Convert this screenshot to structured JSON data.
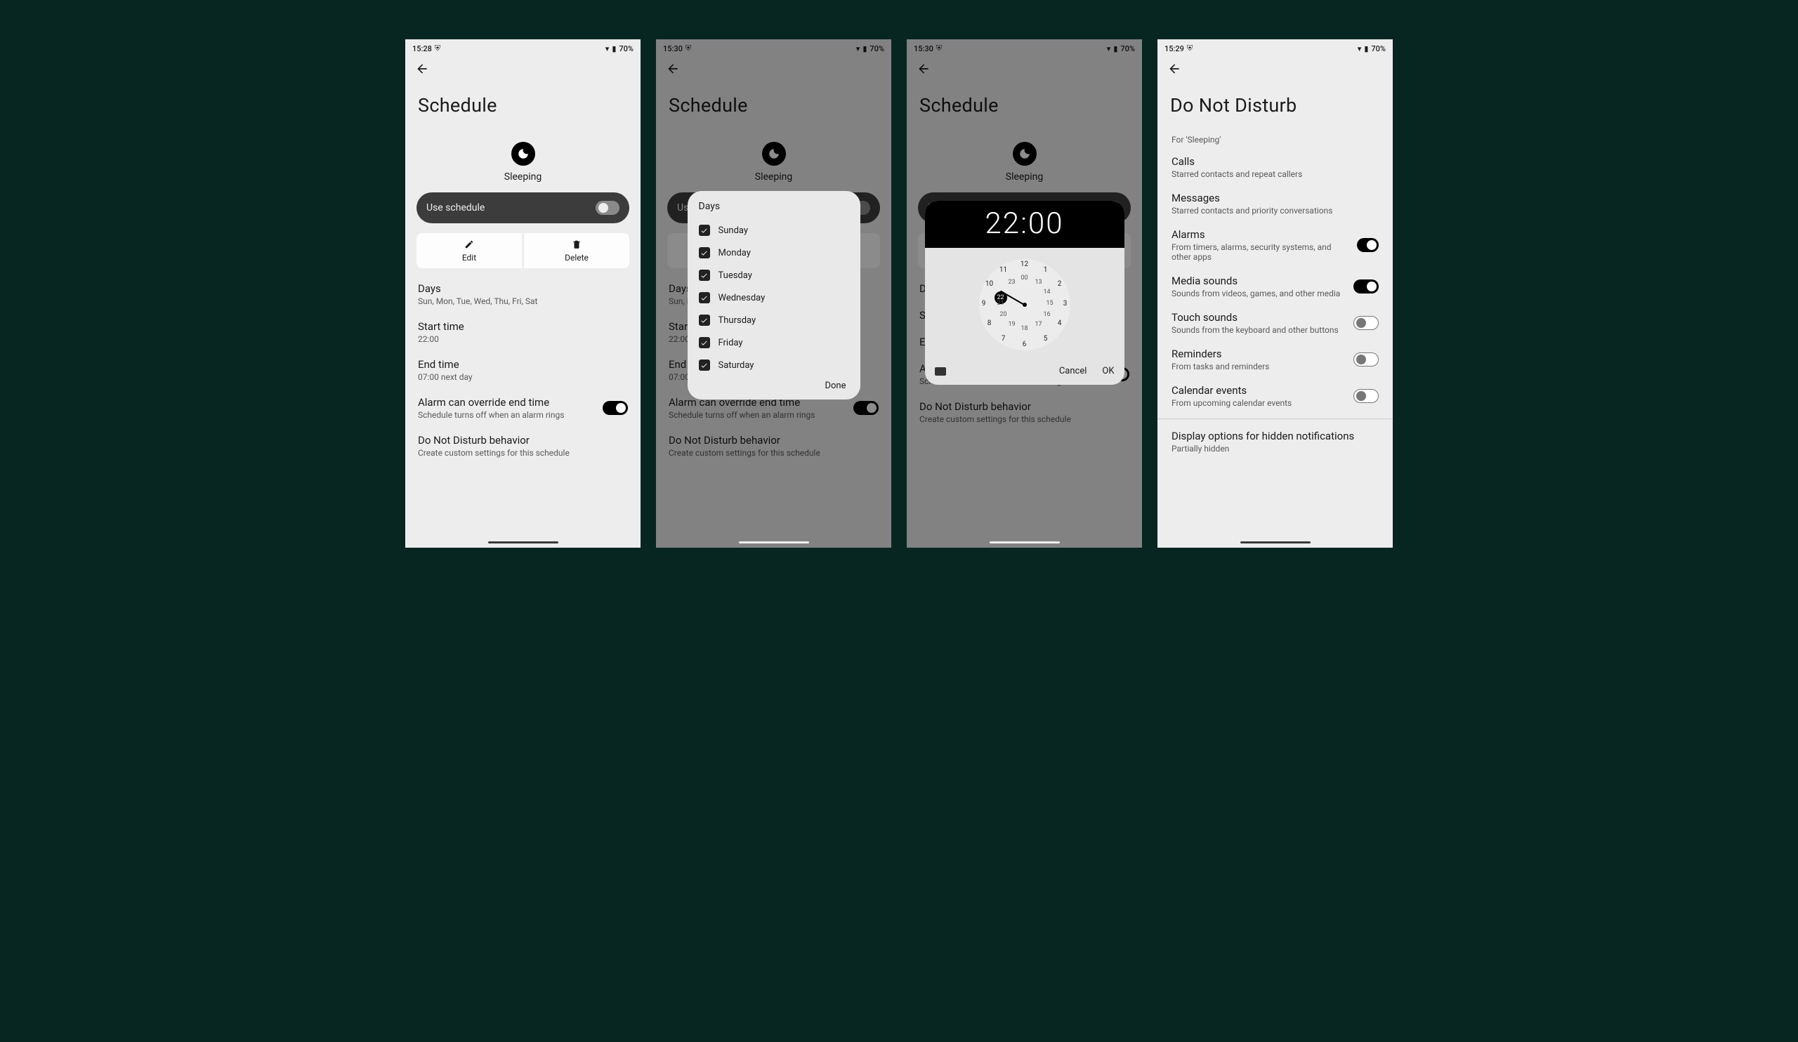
{
  "status": {
    "battery": "70%"
  },
  "screens": [
    {
      "time": "15:28",
      "title": "Schedule",
      "icon_label": "Sleeping",
      "use_schedule_label": "Use schedule",
      "edit_label": "Edit",
      "delete_label": "Delete",
      "items": [
        {
          "title": "Days",
          "sub": "Sun, Mon, Tue, Wed, Thu, Fri, Sat"
        },
        {
          "title": "Start time",
          "sub": "22:00"
        },
        {
          "title": "End time",
          "sub": "07:00 next day"
        },
        {
          "title": "Alarm can override end time",
          "sub": "Schedule turns off when an alarm rings",
          "switch": true,
          "on": true
        },
        {
          "title": "Do Not Disturb behavior",
          "sub": "Create custom settings for this schedule"
        }
      ]
    },
    {
      "time": "15:30",
      "days_dialog": {
        "title": "Days",
        "options": [
          "Sunday",
          "Monday",
          "Tuesday",
          "Wednesday",
          "Thursday",
          "Friday",
          "Saturday"
        ],
        "done": "Done"
      }
    },
    {
      "time": "15:30",
      "time_dialog": {
        "display": "22:00",
        "selected_hour": "22",
        "cancel": "Cancel",
        "ok": "OK"
      }
    },
    {
      "time": "15:29",
      "title": "Do Not Disturb",
      "for_label": "For 'Sleeping'",
      "items": [
        {
          "title": "Calls",
          "sub": "Starred contacts and repeat callers"
        },
        {
          "title": "Messages",
          "sub": "Starred contacts and priority conversations"
        },
        {
          "title": "Alarms",
          "sub": "From timers, alarms, security systems, and other apps",
          "switch": true,
          "on": true
        },
        {
          "title": "Media sounds",
          "sub": "Sounds from videos, games, and other media",
          "switch": true,
          "on": true
        },
        {
          "title": "Touch sounds",
          "sub": "Sounds from the keyboard and other buttons",
          "switch": true,
          "on": false
        },
        {
          "title": "Reminders",
          "sub": "From tasks and reminders",
          "switch": true,
          "on": false
        },
        {
          "title": "Calendar events",
          "sub": "From upcoming calendar events",
          "switch": true,
          "on": false
        }
      ],
      "footer": {
        "title": "Display options for hidden notifications",
        "sub": "Partially hidden"
      }
    }
  ]
}
